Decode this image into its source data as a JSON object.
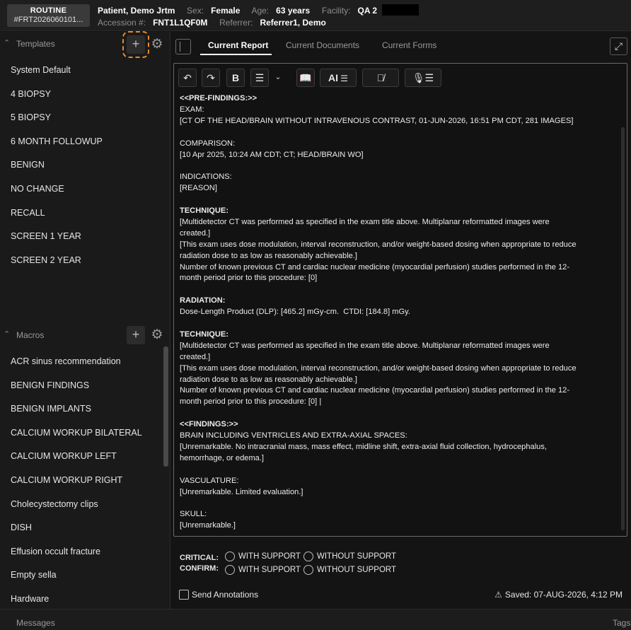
{
  "header": {
    "priority": "ROUTINE",
    "study_id": "#FRT2026060101...",
    "patient_name": "Patient, Demo Jrtm",
    "sex_label": "Sex:",
    "sex": "Female",
    "age_label": "Age:",
    "age": "63 years",
    "facility_label": "Facility:",
    "facility": "QA 2",
    "accession_label": "Accession #:",
    "accession": "FNT1L1QF0M",
    "referrer_label": "Referrer:",
    "referrer": "Referrer1, Demo"
  },
  "templates": {
    "title": "Templates",
    "items": [
      "System Default",
      "4 BIOPSY",
      "5 BIOPSY",
      "6 MONTH FOLLOWUP",
      "BENIGN",
      "NO CHANGE",
      "RECALL",
      "SCREEN 1 YEAR",
      "SCREEN 2 YEAR"
    ]
  },
  "macros": {
    "title": "Macros",
    "items": [
      "ACR sinus recommendation",
      "BENIGN FINDINGS",
      "BENIGN IMPLANTS",
      "CALCIUM WORKUP BILATERAL",
      "CALCIUM WORKUP LEFT",
      "CALCIUM WORKUP RIGHT",
      "Cholecystectomy clips",
      "DISH",
      "Effusion occult fracture",
      "Empty sella",
      "Hardware"
    ]
  },
  "tabs": [
    "Current Report",
    "Current Documents",
    "Current Forms"
  ],
  "toolbar": {
    "ai_label": "AI"
  },
  "report": {
    "lines": [
      {
        "t": "<<PRE-FINDINGS:>>",
        "b": true
      },
      {
        "t": "EXAM:",
        "b": false
      },
      {
        "t": "[CT OF THE HEAD/BRAIN WITHOUT INTRAVENOUS CONTRAST, 01-JUN-2026, 16:51 PM CDT, 281 IMAGES]",
        "b": false
      },
      {
        "t": "",
        "b": false
      },
      {
        "t": "COMPARISON:",
        "b": false
      },
      {
        "t": "[10 Apr 2025, 10:24 AM CDT; CT; HEAD/BRAIN WO]",
        "b": false
      },
      {
        "t": "",
        "b": false
      },
      {
        "t": "INDICATIONS:",
        "b": false
      },
      {
        "t": "[REASON]",
        "b": false
      },
      {
        "t": "",
        "b": false
      },
      {
        "t": "TECHNIQUE:",
        "b": true
      },
      {
        "t": "[Multidetector CT was performed as specified in the exam title above. Multiplanar reformatted images were",
        "b": false
      },
      {
        "t": "created.]",
        "b": false
      },
      {
        "t": "[This exam uses dose modulation, interval reconstruction, and/or weight-based dosing when appropriate to reduce",
        "b": false
      },
      {
        "t": "radiation dose to as low as reasonably achievable.]",
        "b": false
      },
      {
        "t": "Number of known previous CT and cardiac nuclear medicine (myocardial perfusion) studies performed in the 12-",
        "b": false
      },
      {
        "t": "month period prior to this procedure: [0]",
        "b": false
      },
      {
        "t": "",
        "b": false
      },
      {
        "t": "RADIATION:",
        "b": true
      },
      {
        "t": "Dose-Length Product (DLP): [465.2] mGy-cm.  CTDI: [184.8] mGy.",
        "b": false
      },
      {
        "t": "",
        "b": false
      },
      {
        "t": "TECHNIQUE:",
        "b": true
      },
      {
        "t": "[Multidetector CT was performed as specified in the exam title above. Multiplanar reformatted images were",
        "b": false
      },
      {
        "t": "created.]",
        "b": false
      },
      {
        "t": "[This exam uses dose modulation, interval reconstruction, and/or weight-based dosing when appropriate to reduce",
        "b": false
      },
      {
        "t": "radiation dose to as low as reasonably achievable.]",
        "b": false
      },
      {
        "t": "Number of known previous CT and cardiac nuclear medicine (myocardial perfusion) studies performed in the 12-",
        "b": false
      },
      {
        "t": "month period prior to this procedure: [0] |",
        "b": false
      },
      {
        "t": "",
        "b": false
      },
      {
        "t": "<<FINDINGS:>>",
        "b": true
      },
      {
        "t": "BRAIN INCLUDING VENTRICLES AND EXTRA-AXIAL SPACES:",
        "b": false
      },
      {
        "t": "[Unremarkable. No intracranial mass, mass effect, midline shift, extra-axial fluid collection, hydrocephalus,",
        "b": false
      },
      {
        "t": "hemorrhage, or edema.]",
        "b": false
      },
      {
        "t": "",
        "b": false
      },
      {
        "t": "VASCULATURE:",
        "b": false
      },
      {
        "t": "[Unremarkable. Limited evaluation.]",
        "b": false
      },
      {
        "t": "",
        "b": false
      },
      {
        "t": "SKULL:",
        "b": false
      },
      {
        "t": "[Unremarkable.]",
        "b": false
      }
    ]
  },
  "critical": {
    "critical_label": "CRITICAL:",
    "confirm_label": "CONFIRM:",
    "with_support": "WITH SUPPORT",
    "without_support": "WITHOUT SUPPORT"
  },
  "bottom": {
    "send_annotations": "Send Annotations",
    "saved": "Saved: 07-AUG-2026, 4:12 PM"
  },
  "footer": {
    "messages": "Messages",
    "tags": "Tags"
  },
  "colors": {
    "accent_dashed": "#e8892a",
    "background": "#141414"
  }
}
